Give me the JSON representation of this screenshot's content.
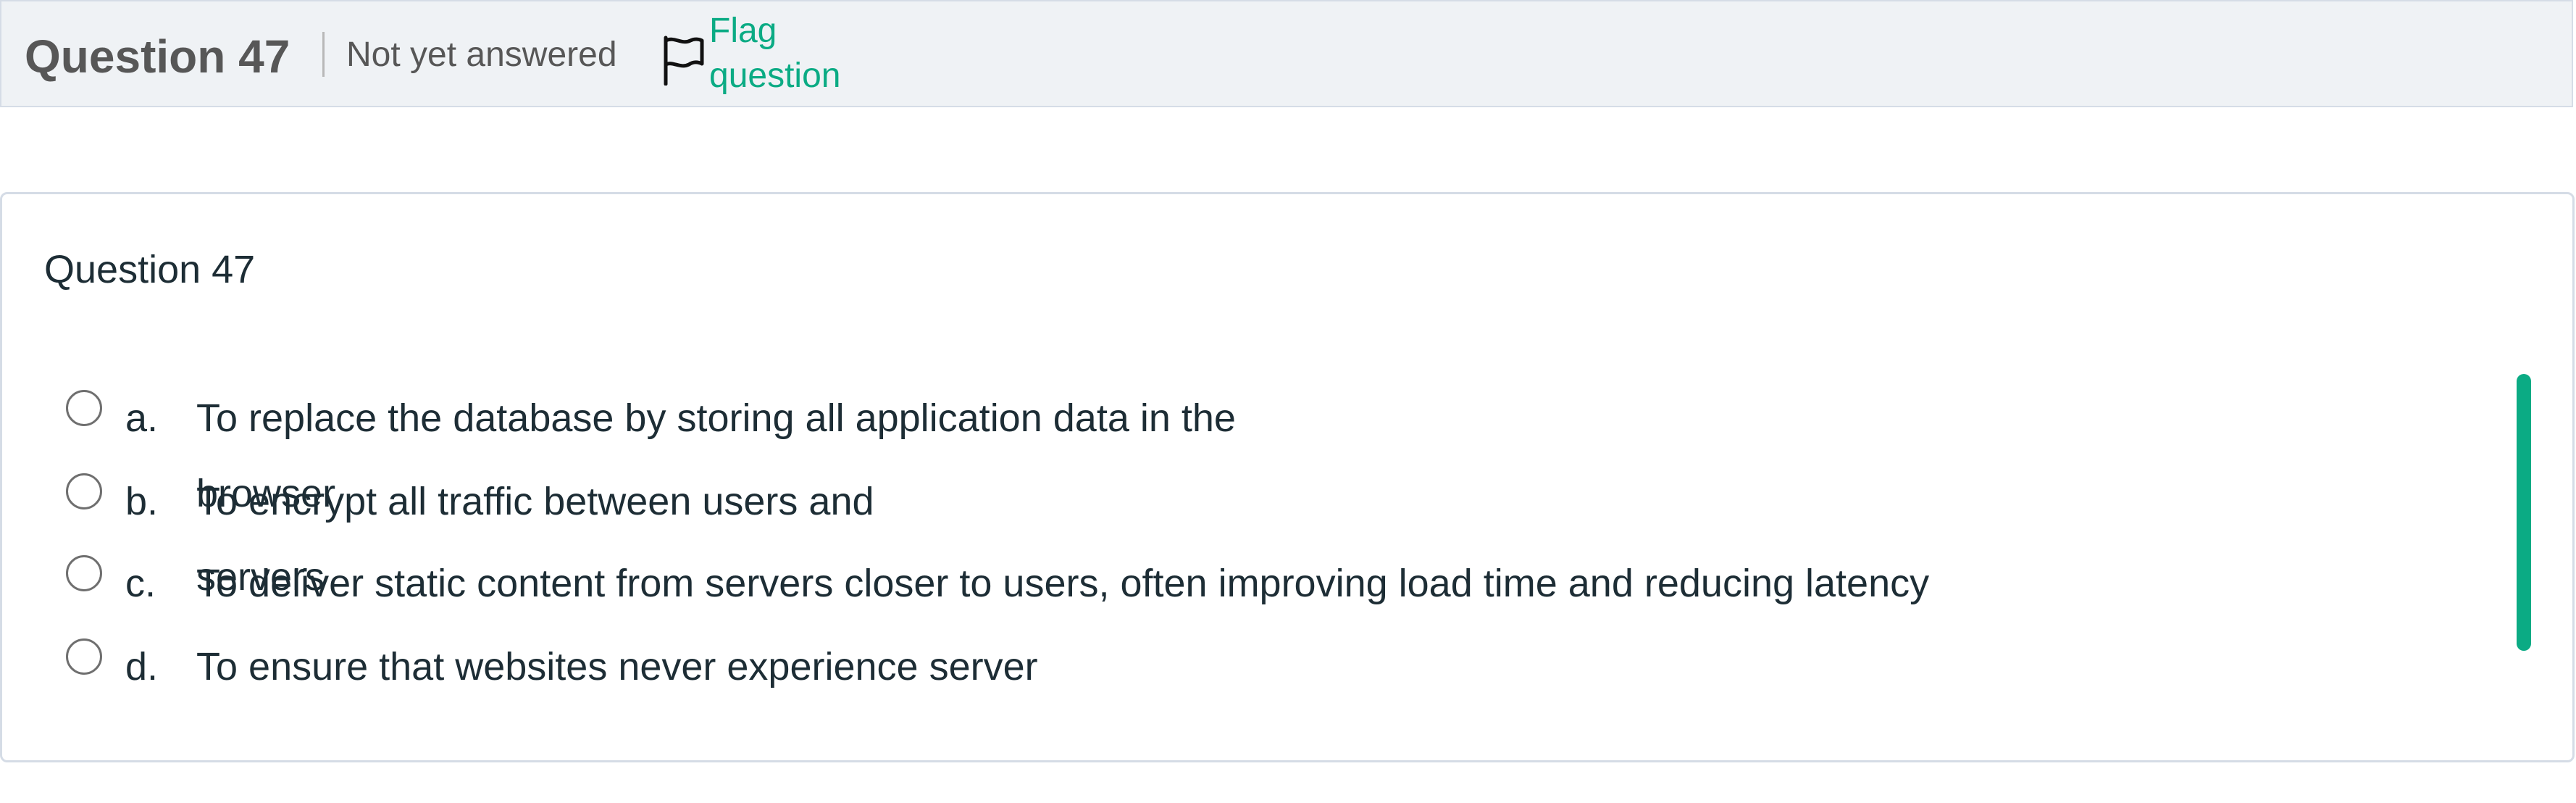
{
  "header": {
    "question_number": "Question 47",
    "state": "Not yet answered",
    "flag_label": "Flag question"
  },
  "card": {
    "title": "Question 47",
    "answers": [
      {
        "letter": "a.",
        "text": "To replace the database by storing all application data in the browser"
      },
      {
        "letter": "b.",
        "text": "To encrypt all traffic between users and servers"
      },
      {
        "letter": "c.",
        "text": "To deliver static content from servers closer to users, often improving load time and reducing latency"
      },
      {
        "letter": "d.",
        "text": "To ensure that websites never experience server"
      }
    ]
  },
  "colors": {
    "accent": "#0bab84",
    "header_bg": "#eff2f5",
    "border": "#d5dce6",
    "text": "#1d2d35"
  }
}
